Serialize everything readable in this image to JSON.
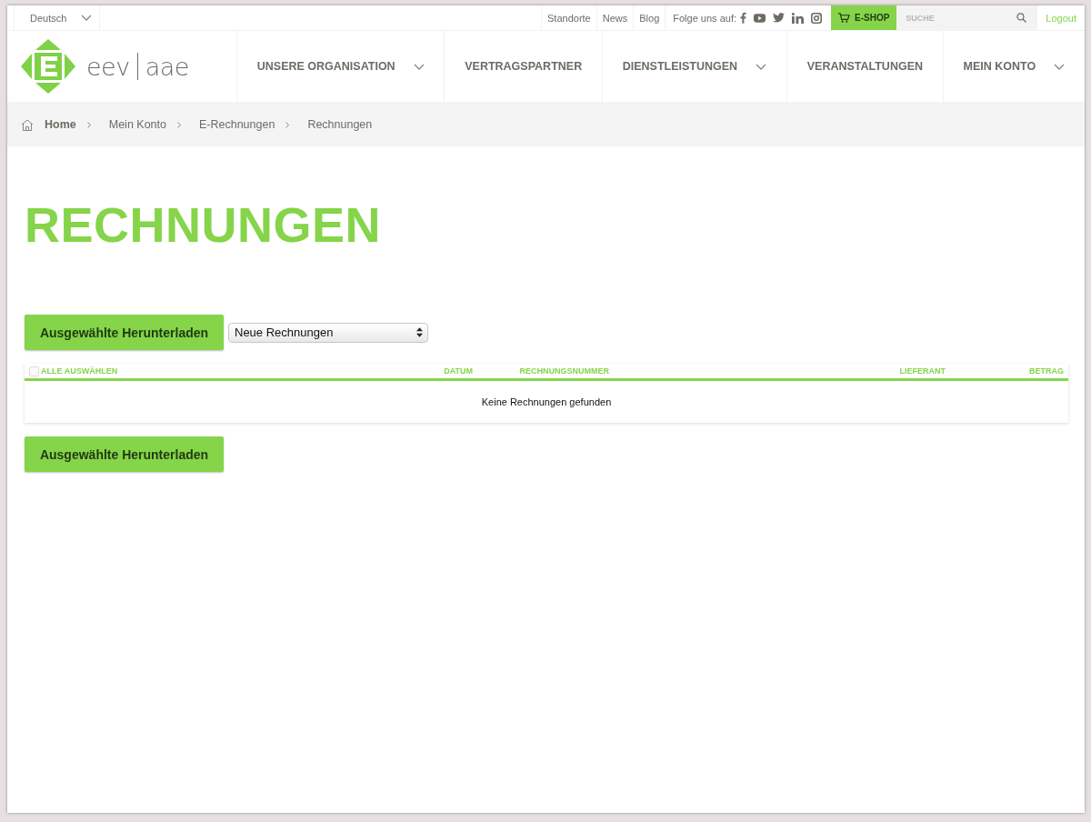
{
  "top_bar": {
    "language": "Deutsch",
    "links": [
      "Standorte",
      "News",
      "Blog"
    ],
    "social_label": "Folge uns auf:",
    "social": [
      {
        "kind": "facebook"
      },
      {
        "kind": "youtube"
      },
      {
        "kind": "twitter"
      },
      {
        "kind": "linkedin"
      },
      {
        "kind": "instagram"
      }
    ],
    "shop": "E-SHOP",
    "search": {
      "placeholder": "SUCHE"
    },
    "logout": "Logout"
  },
  "logo": {
    "left": "eev",
    "right": "aae"
  },
  "nav": [
    {
      "label": "UNSERE ORGANISATION",
      "dropdown": true
    },
    {
      "label": "VERTRAGSPARTNER",
      "dropdown": false
    },
    {
      "label": "DIENSTLEISTUNGEN",
      "dropdown": true
    },
    {
      "label": "VERANSTALTUNGEN",
      "dropdown": false
    },
    {
      "label": "MEIN KONTO",
      "dropdown": true
    }
  ],
  "breadcrumb": [
    "Home",
    "Mein Konto",
    "E-Rechnungen",
    "Rechnungen"
  ],
  "page_title": "RECHNUNGEN",
  "download_button": "Ausgewählte Herunterladen",
  "filter": {
    "value": "Neue Rechnungen"
  },
  "table": {
    "select_all": {
      "label": "ALLE AUSWÄHLEN",
      "checked": false
    },
    "columns": [
      "DATUM",
      "RECHNUNGSNUMMER",
      "LIEFERANT",
      "BETRAG"
    ],
    "empty": "Keine Rechnungen gefunden"
  },
  "bottom_button": "Ausgewählte Herunterladen"
}
